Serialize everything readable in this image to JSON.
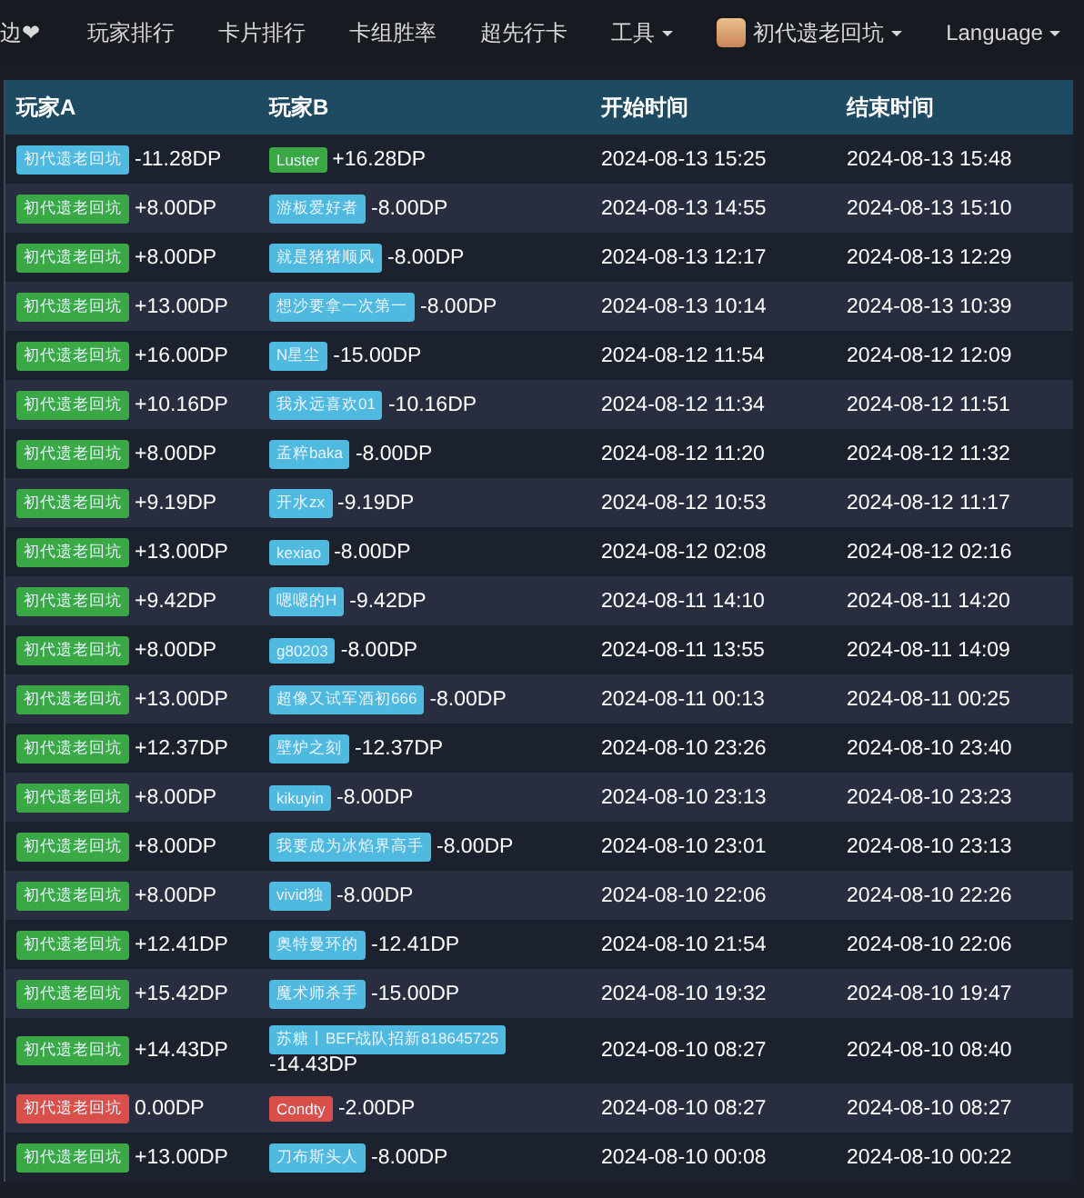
{
  "nav": [
    {
      "label": "边❤",
      "dropdown": false,
      "avatar": false
    },
    {
      "label": "玩家排行",
      "dropdown": false,
      "avatar": false
    },
    {
      "label": "卡片排行",
      "dropdown": false,
      "avatar": false
    },
    {
      "label": "卡组胜率",
      "dropdown": false,
      "avatar": false
    },
    {
      "label": "超先行卡",
      "dropdown": false,
      "avatar": false
    },
    {
      "label": "工具",
      "dropdown": true,
      "avatar": false
    },
    {
      "label": "初代遗老回坑",
      "dropdown": true,
      "avatar": true
    },
    {
      "label": "Language",
      "dropdown": true,
      "avatar": false
    }
  ],
  "table": {
    "columns": [
      "玩家A",
      "玩家B",
      "开始时间",
      "结束时间"
    ],
    "rows": [
      {
        "a": {
          "name": "初代遗老回坑",
          "kind": "lose",
          "dp": "-11.28DP"
        },
        "b": {
          "name": "Luster",
          "kind": "win",
          "dp": "+16.28DP"
        },
        "start": "2024-08-13 15:25",
        "end": "2024-08-13 15:48"
      },
      {
        "a": {
          "name": "初代遗老回坑",
          "kind": "win",
          "dp": "+8.00DP"
        },
        "b": {
          "name": "游板爱好者",
          "kind": "lose",
          "dp": "-8.00DP"
        },
        "start": "2024-08-13 14:55",
        "end": "2024-08-13 15:10"
      },
      {
        "a": {
          "name": "初代遗老回坑",
          "kind": "win",
          "dp": "+8.00DP"
        },
        "b": {
          "name": "就是猪猪顺风",
          "kind": "lose",
          "dp": "-8.00DP"
        },
        "start": "2024-08-13 12:17",
        "end": "2024-08-13 12:29"
      },
      {
        "a": {
          "name": "初代遗老回坑",
          "kind": "win",
          "dp": "+13.00DP"
        },
        "b": {
          "name": "想沙要拿一次第一",
          "kind": "lose",
          "dp": "-8.00DP"
        },
        "start": "2024-08-13 10:14",
        "end": "2024-08-13 10:39"
      },
      {
        "a": {
          "name": "初代遗老回坑",
          "kind": "win",
          "dp": "+16.00DP"
        },
        "b": {
          "name": "N星尘",
          "kind": "lose",
          "dp": "-15.00DP"
        },
        "start": "2024-08-12 11:54",
        "end": "2024-08-12 12:09"
      },
      {
        "a": {
          "name": "初代遗老回坑",
          "kind": "win",
          "dp": "+10.16DP"
        },
        "b": {
          "name": "我永远喜欢01",
          "kind": "lose",
          "dp": "-10.16DP"
        },
        "start": "2024-08-12 11:34",
        "end": "2024-08-12 11:51"
      },
      {
        "a": {
          "name": "初代遗老回坑",
          "kind": "win",
          "dp": "+8.00DP"
        },
        "b": {
          "name": "孟粹baka",
          "kind": "lose",
          "dp": "-8.00DP"
        },
        "start": "2024-08-12 11:20",
        "end": "2024-08-12 11:32"
      },
      {
        "a": {
          "name": "初代遗老回坑",
          "kind": "win",
          "dp": "+9.19DP"
        },
        "b": {
          "name": "开水zx",
          "kind": "lose",
          "dp": "-9.19DP"
        },
        "start": "2024-08-12 10:53",
        "end": "2024-08-12 11:17"
      },
      {
        "a": {
          "name": "初代遗老回坑",
          "kind": "win",
          "dp": "+13.00DP"
        },
        "b": {
          "name": "kexiao",
          "kind": "lose",
          "dp": "-8.00DP"
        },
        "start": "2024-08-12 02:08",
        "end": "2024-08-12 02:16"
      },
      {
        "a": {
          "name": "初代遗老回坑",
          "kind": "win",
          "dp": "+9.42DP"
        },
        "b": {
          "name": "嗯嗯的H",
          "kind": "lose",
          "dp": "-9.42DP"
        },
        "start": "2024-08-11 14:10",
        "end": "2024-08-11 14:20"
      },
      {
        "a": {
          "name": "初代遗老回坑",
          "kind": "win",
          "dp": "+8.00DP"
        },
        "b": {
          "name": "g80203",
          "kind": "lose",
          "dp": "-8.00DP"
        },
        "start": "2024-08-11 13:55",
        "end": "2024-08-11 14:09"
      },
      {
        "a": {
          "name": "初代遗老回坑",
          "kind": "win",
          "dp": "+13.00DP"
        },
        "b": {
          "name": "超像又试军酒初666",
          "kind": "lose",
          "dp": "-8.00DP"
        },
        "start": "2024-08-11 00:13",
        "end": "2024-08-11 00:25"
      },
      {
        "a": {
          "name": "初代遗老回坑",
          "kind": "win",
          "dp": "+12.37DP"
        },
        "b": {
          "name": "壁炉之刻",
          "kind": "lose",
          "dp": "-12.37DP"
        },
        "start": "2024-08-10 23:26",
        "end": "2024-08-10 23:40"
      },
      {
        "a": {
          "name": "初代遗老回坑",
          "kind": "win",
          "dp": "+8.00DP"
        },
        "b": {
          "name": "kikuyin",
          "kind": "lose",
          "dp": "-8.00DP"
        },
        "start": "2024-08-10 23:13",
        "end": "2024-08-10 23:23"
      },
      {
        "a": {
          "name": "初代遗老回坑",
          "kind": "win",
          "dp": "+8.00DP"
        },
        "b": {
          "name": "我要成为冰焰界高手",
          "kind": "lose",
          "dp": "-8.00DP"
        },
        "start": "2024-08-10 23:01",
        "end": "2024-08-10 23:13"
      },
      {
        "a": {
          "name": "初代遗老回坑",
          "kind": "win",
          "dp": "+8.00DP"
        },
        "b": {
          "name": "vivid独",
          "kind": "lose",
          "dp": "-8.00DP"
        },
        "start": "2024-08-10 22:06",
        "end": "2024-08-10 22:26"
      },
      {
        "a": {
          "name": "初代遗老回坑",
          "kind": "win",
          "dp": "+12.41DP"
        },
        "b": {
          "name": "奥特曼环的",
          "kind": "lose",
          "dp": "-12.41DP"
        },
        "start": "2024-08-10 21:54",
        "end": "2024-08-10 22:06"
      },
      {
        "a": {
          "name": "初代遗老回坑",
          "kind": "win",
          "dp": "+15.42DP"
        },
        "b": {
          "name": "魔术师杀手",
          "kind": "lose",
          "dp": "-15.00DP"
        },
        "start": "2024-08-10 19:32",
        "end": "2024-08-10 19:47"
      },
      {
        "a": {
          "name": "初代遗老回坑",
          "kind": "win",
          "dp": "+14.43DP"
        },
        "b": {
          "name": "苏糖丨BEF战队招新818645725",
          "kind": "lose",
          "dp": "-14.43DP"
        },
        "start": "2024-08-10 08:27",
        "end": "2024-08-10 08:40"
      },
      {
        "a": {
          "name": "初代遗老回坑",
          "kind": "draw",
          "dp": "0.00DP"
        },
        "b": {
          "name": "Condty",
          "kind": "draw",
          "dp": "-2.00DP"
        },
        "start": "2024-08-10 08:27",
        "end": "2024-08-10 08:27"
      },
      {
        "a": {
          "name": "初代遗老回坑",
          "kind": "win",
          "dp": "+13.00DP"
        },
        "b": {
          "name": "刀布斯头人",
          "kind": "lose",
          "dp": "-8.00DP"
        },
        "start": "2024-08-10 00:08",
        "end": "2024-08-10 00:22"
      }
    ]
  }
}
